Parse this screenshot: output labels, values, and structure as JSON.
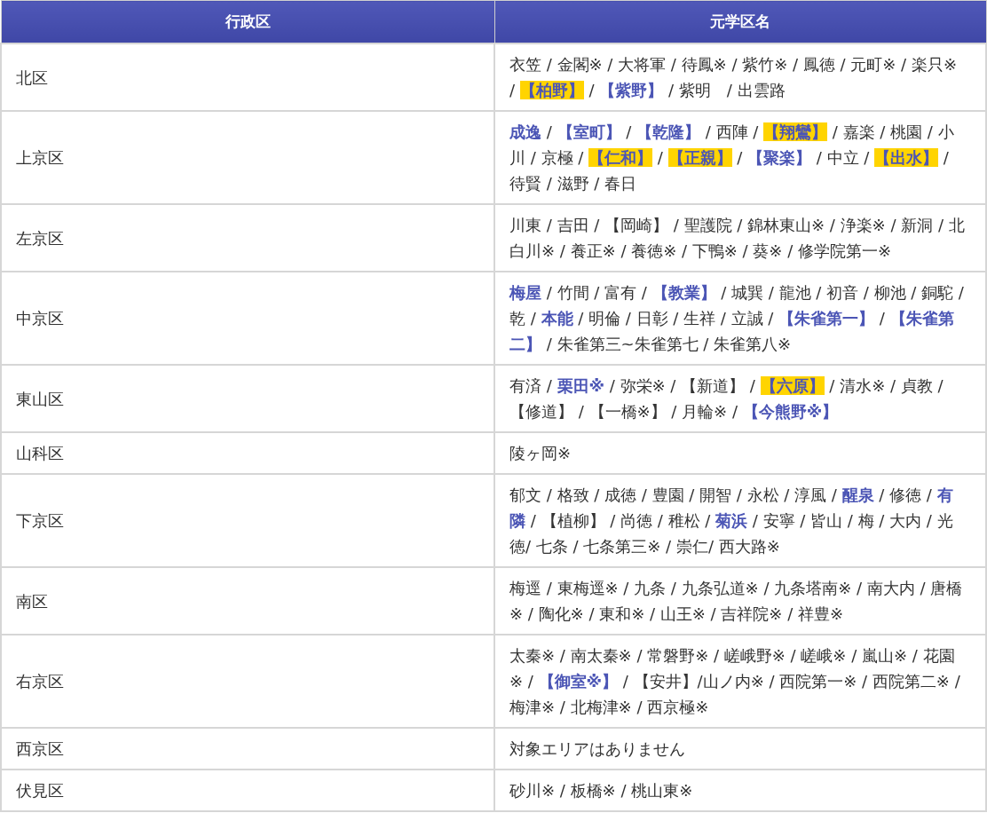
{
  "table": {
    "columns": [
      "行政区",
      "元学区名"
    ],
    "rows": [
      {
        "ward": "北区",
        "areas": [
          {
            "kind": "plain",
            "text": "衣笠 / 金閣※ / 大将軍 / 待鳳※ / 紫竹※ / 鳳徳 / 元町※ / 楽只※ / "
          },
          {
            "kind": "marked",
            "text": "【柏野】"
          },
          {
            "kind": "plain",
            "text": " / "
          },
          {
            "kind": "bold",
            "text": "【紫野】"
          },
          {
            "kind": "plain",
            "text": " / 紫明　/ 出雲路"
          }
        ]
      },
      {
        "ward": "上京区",
        "areas": [
          {
            "kind": "bold",
            "text": "成逸"
          },
          {
            "kind": "plain",
            "text": " / "
          },
          {
            "kind": "bold",
            "text": "【室町】"
          },
          {
            "kind": "plain",
            "text": " / "
          },
          {
            "kind": "bold",
            "text": "【乾隆】"
          },
          {
            "kind": "plain",
            "text": " / 西陣 / "
          },
          {
            "kind": "marked",
            "text": "【翔鸞】"
          },
          {
            "kind": "plain",
            "text": " / 嘉楽 / 桃園 / 小川 / 京極 / "
          },
          {
            "kind": "marked",
            "text": "【仁和】"
          },
          {
            "kind": "plain",
            "text": " / "
          },
          {
            "kind": "marked",
            "text": "【正親】"
          },
          {
            "kind": "plain",
            "text": " / "
          },
          {
            "kind": "bold",
            "text": "【聚楽】"
          },
          {
            "kind": "plain",
            "text": " / 中立 / "
          },
          {
            "kind": "marked",
            "text": "【出水】"
          },
          {
            "kind": "plain",
            "text": " / 待賢 / 滋野 / 春日"
          }
        ]
      },
      {
        "ward": "左京区",
        "areas": [
          {
            "kind": "plain",
            "text": "川東 / 吉田 / 【岡崎】 / 聖護院 / 錦林東山※ / 浄楽※ / 新洞 / 北白川※ / 養正※ / 養徳※ / 下鴨※ / 葵※ / 修学院第一※"
          }
        ]
      },
      {
        "ward": "中京区",
        "areas": [
          {
            "kind": "bold",
            "text": "梅屋"
          },
          {
            "kind": "plain",
            "text": " / 竹間 / 富有 / "
          },
          {
            "kind": "bold",
            "text": "【教業】"
          },
          {
            "kind": "plain",
            "text": " / 城巽 / 龍池 / 初音 / 柳池 / 銅駝 / 乾 / "
          },
          {
            "kind": "bold",
            "text": "本能"
          },
          {
            "kind": "plain",
            "text": " / 明倫 / 日彰 / 生祥 / 立誠 / "
          },
          {
            "kind": "bold",
            "text": "【朱雀第一】"
          },
          {
            "kind": "plain",
            "text": " / "
          },
          {
            "kind": "bold",
            "text": "【朱雀第二】"
          },
          {
            "kind": "plain",
            "text": " / 朱雀第三~朱雀第七 / 朱雀第八※"
          }
        ]
      },
      {
        "ward": "東山区",
        "areas": [
          {
            "kind": "plain",
            "text": "有済 / "
          },
          {
            "kind": "bold",
            "text": "栗田※"
          },
          {
            "kind": "plain",
            "text": " / 弥栄※ / 【新道】 / "
          },
          {
            "kind": "marked",
            "text": "【六原】"
          },
          {
            "kind": "plain",
            "text": " / 清水※ / 貞教 / 【修道】 / 【一橋※】 / 月輪※ / "
          },
          {
            "kind": "bold",
            "text": "【今熊野※】"
          }
        ]
      },
      {
        "ward": "山科区",
        "areas": [
          {
            "kind": "plain",
            "text": "陵ヶ岡※"
          }
        ]
      },
      {
        "ward": "下京区",
        "areas": [
          {
            "kind": "plain",
            "text": "郁文 / 格致 / 成徳 / 豊園 / 開智 / 永松 / 淳風 / "
          },
          {
            "kind": "bold",
            "text": "醒泉"
          },
          {
            "kind": "plain",
            "text": " / 修徳 / "
          },
          {
            "kind": "bold",
            "text": "有隣"
          },
          {
            "kind": "plain",
            "text": " / 【植柳】 / 尚徳 / 稚松 / "
          },
          {
            "kind": "bold",
            "text": "菊浜"
          },
          {
            "kind": "plain",
            "text": " / 安寧 / 皆山 / 梅 / 大内 / 光徳/ 七条 / 七条第三※ / 崇仁/ 西大路※"
          }
        ]
      },
      {
        "ward": "南区",
        "areas": [
          {
            "kind": "plain",
            "text": "梅逕 / 東梅逕※ / 九条 / 九条弘道※ / 九条塔南※ / 南大内 / 唐橋※ / 陶化※ / 東和※ / 山王※ / 吉祥院※ / 祥豊※"
          }
        ]
      },
      {
        "ward": "右京区",
        "areas": [
          {
            "kind": "plain",
            "text": "太秦※ / 南太秦※ / 常磐野※ / 嵯峨野※ / 嵯峨※ / 嵐山※ / 花園※ / "
          },
          {
            "kind": "bold",
            "text": "【御室※】"
          },
          {
            "kind": "plain",
            "text": " / 【安井】/山ノ内※ / 西院第一※ / 西院第二※ / 梅津※ / 北梅津※ / 西京極※"
          }
        ]
      },
      {
        "ward": "西京区",
        "areas": [
          {
            "kind": "plain",
            "text": "対象エリアはありません"
          }
        ]
      },
      {
        "ward": "伏見区",
        "areas": [
          {
            "kind": "plain",
            "text": "砂川※ / 板橋※ / 桃山東※"
          }
        ]
      }
    ]
  }
}
